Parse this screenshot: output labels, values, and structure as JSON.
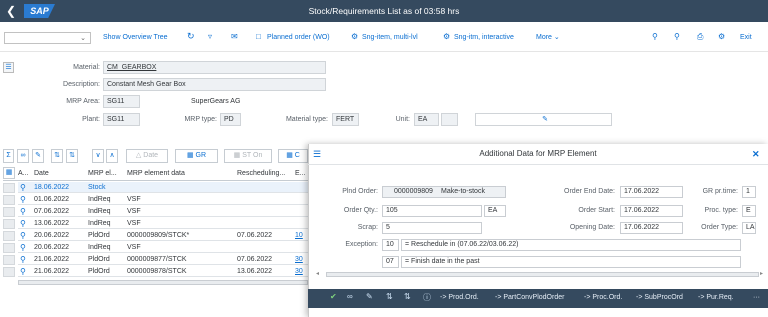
{
  "shell": {
    "title": "Stock/Requirements List as of 03:58 hrs",
    "logo": "SAP",
    "back_icon": "back-arrow-icon"
  },
  "toolbar": {
    "select_value": "",
    "items": [
      {
        "label": "Show Overview Tree"
      },
      {
        "icon": "refresh-icon"
      },
      {
        "icon": "filter-icon"
      },
      {
        "icon": "mail-icon"
      },
      {
        "label": "Planned order (WO)",
        "icon": "document-icon"
      },
      {
        "label": "Sng-item, multi-lvl",
        "icon": "gear-icon"
      },
      {
        "label": "Sng-itm, interactive",
        "icon": "gear-icon"
      },
      {
        "label": "More"
      }
    ],
    "right": [
      {
        "icon": "search-icon"
      },
      {
        "icon": "search-plus-icon"
      },
      {
        "icon": "print-icon"
      },
      {
        "icon": "settings-icon"
      },
      {
        "label": "Exit"
      }
    ]
  },
  "header": {
    "material_label": "Material:",
    "material": "CM_GEARBOX",
    "description_label": "Description:",
    "description": "Constant Mesh Gear Box",
    "mrp_area_label": "MRP Area:",
    "mrp_area": "SG11",
    "mrp_area_name": "SuperGears AG",
    "plant_label": "Plant:",
    "plant": "SG11",
    "mrp_type_label": "MRP type:",
    "mrp_type": "PD",
    "material_type_label": "Material type:",
    "material_type": "FERT",
    "unit_label": "Unit:",
    "unit": "EA"
  },
  "grid_toolbar": {
    "date": "Date",
    "gr": "GR",
    "st_on": "ST On"
  },
  "table": {
    "headers": [
      "A...",
      "Date",
      "MRP el...",
      "MRP element data",
      "Rescheduling...",
      "E..."
    ],
    "rows": [
      {
        "date": "18.06.2022",
        "el": "Stock",
        "data": "",
        "resched": "",
        "e": "",
        "highlight": true
      },
      {
        "date": "01.06.2022",
        "el": "IndReq",
        "data": "VSF",
        "resched": "",
        "e": ""
      },
      {
        "date": "07.06.2022",
        "el": "IndReq",
        "data": "VSF",
        "resched": "",
        "e": ""
      },
      {
        "date": "13.06.2022",
        "el": "IndReq",
        "data": "VSF",
        "resched": "",
        "e": ""
      },
      {
        "date": "20.06.2022",
        "el": "PldOrd",
        "data": "0000009809/STCK*",
        "resched": "07.06.2022",
        "e": "10"
      },
      {
        "date": "20.06.2022",
        "el": "IndReq",
        "data": "VSF",
        "resched": "",
        "e": ""
      },
      {
        "date": "21.06.2022",
        "el": "PldOrd",
        "data": "0000009877/STCK",
        "resched": "07.06.2022",
        "e": "30"
      },
      {
        "date": "21.06.2022",
        "el": "PldOrd",
        "data": "0000009878/STCK",
        "resched": "13.06.2022",
        "e": "30"
      }
    ]
  },
  "dialog": {
    "title": "Additional Data for MRP Element",
    "pld_order_label": "Plnd Order:",
    "pld_order": "0000009809",
    "pld_order_type": "Make-to-stock",
    "order_qty_label": "Order Qty.:",
    "order_qty": "105",
    "order_qty_unit": "EA",
    "scrap_label": "Scrap:",
    "scrap": "5",
    "exception_label": "Exception:",
    "exception1_code": "10",
    "exception1_text": "Reschedule in (07.06.22/03.06.22)",
    "exception2_code": "07",
    "exception2_text": "Finish date in the past",
    "order_end_label": "Order End Date:",
    "order_end": "17.06.2022",
    "order_start_label": "Order Start:",
    "order_start": "17.06.2022",
    "opening_label": "Opening Date:",
    "opening": "17.06.2022",
    "gr_pr_time_label": "GR pr.time:",
    "gr_pr_time": "1",
    "proc_type_label": "Proc. type:",
    "proc_type": "E",
    "order_type_label": "Order Type:",
    "order_type": "LA",
    "footer": [
      "-> Prod.Ord.",
      "-> PartConvPlodOrder",
      "-> Proc.Ord.",
      "-> SubProcOrd",
      "-> Pur.Req."
    ]
  },
  "colors": {
    "shell": "#354a5f",
    "accent": "#0a6ed1"
  }
}
